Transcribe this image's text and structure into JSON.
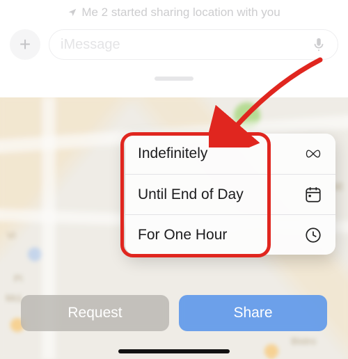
{
  "status_text": "Me 2 started sharing location with you",
  "input": {
    "placeholder": "iMessage"
  },
  "popup": {
    "options": [
      {
        "label": "Indefinitely",
        "icon": "infinity-icon"
      },
      {
        "label": "Until End of Day",
        "icon": "calendar-icon"
      },
      {
        "label": "For One Hour",
        "icon": "clock-icon"
      }
    ]
  },
  "buttons": {
    "request": "Request",
    "share": "Share"
  },
  "map_labels": {
    "pi": "Pi",
    "mcl": "McL",
    "vi": "Vi",
    "se": "SE",
    "bistro": "Bistro"
  }
}
